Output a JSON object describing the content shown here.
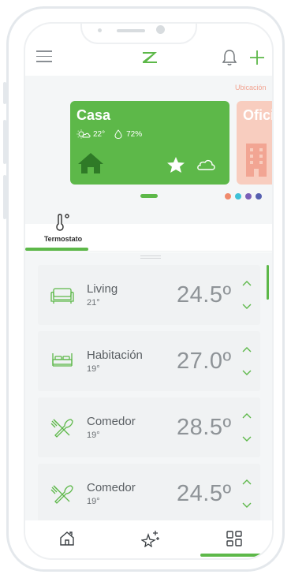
{
  "header": {
    "menu_icon": "hamburger-icon",
    "logo_icon": "brand-logo-icon",
    "bell_icon": "bell-icon",
    "add_icon": "plus-icon"
  },
  "locations": {
    "label": "Ubicación",
    "cards": [
      {
        "name": "Casa",
        "temperature": "22°",
        "humidity": "72%",
        "color": "#5db849",
        "icons": [
          "home-icon",
          "star-icon",
          "cloud-icon"
        ]
      },
      {
        "name": "Oficina",
        "color": "#f8cdbf",
        "icons": [
          "building-icon"
        ]
      }
    ],
    "dots": [
      "#f08a6c",
      "#3ec1d8",
      "#7b5fb8",
      "#5660b0"
    ]
  },
  "tabs": [
    {
      "label": "Termostato",
      "icon": "thermometer-icon",
      "active": true
    }
  ],
  "rooms": [
    {
      "name": "Living",
      "current": "21°",
      "setpoint": "24.5º",
      "icon": "sofa-icon"
    },
    {
      "name": "Habitación",
      "current": "19°",
      "setpoint": "27.0º",
      "icon": "bed-icon"
    },
    {
      "name": "Comedor",
      "current": "19°",
      "setpoint": "28.5º",
      "icon": "fork-knife-icon"
    },
    {
      "name": "Comedor",
      "current": "19°",
      "setpoint": "24.5º",
      "icon": "fork-knife-icon"
    }
  ],
  "bottom_nav": [
    {
      "icon": "home-icon"
    },
    {
      "icon": "sparkles-icon"
    },
    {
      "icon": "grid-icon",
      "active": true
    }
  ],
  "colors": {
    "accent": "#5db849",
    "secondary": "#f8cdbf"
  }
}
